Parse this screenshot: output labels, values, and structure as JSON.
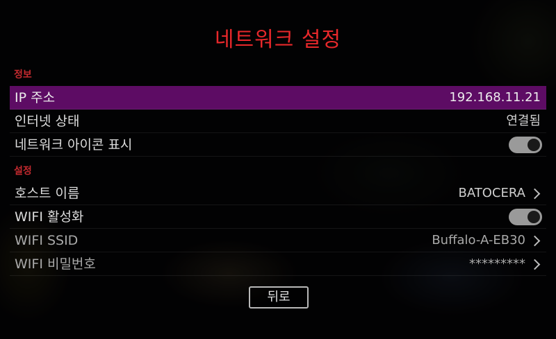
{
  "title": "네트워크 설정",
  "sections": {
    "info": "정보",
    "settings": "설정"
  },
  "rows": {
    "ip": {
      "label": "IP 주소",
      "value": "192.168.11.21"
    },
    "internet": {
      "label": "인터넷 상태",
      "value": "연결됨"
    },
    "network_icon": {
      "label": "네트워크 아이콘 표시",
      "toggle": true
    },
    "hostname": {
      "label": "호스트 이름",
      "value": "BATOCERA"
    },
    "wifi_enable": {
      "label": "WIFI 활성화",
      "toggle": true
    },
    "wifi_ssid": {
      "label": "WIFI SSID",
      "value": "Buffalo-A-EB30"
    },
    "wifi_password": {
      "label": "WIFI 비밀번호",
      "value": "*********"
    }
  },
  "back_button": "뒤로",
  "colors": {
    "title": "#e8282b",
    "section": "#c42a2f",
    "selected_row": "#5d0c64"
  }
}
